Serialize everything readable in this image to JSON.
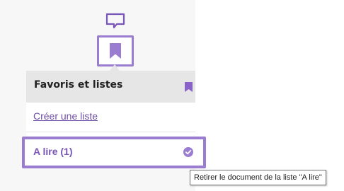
{
  "toolbar": {
    "comment_icon": "speech-bubble-icon",
    "bookmark_icon": "bookmark-icon"
  },
  "favorites_panel": {
    "title": "Favoris et listes",
    "header_icon": "bookmark-icon",
    "create_list_label": "Créer une liste",
    "lists": [
      {
        "label": "A lire (1)",
        "selected": true,
        "icon": "check-circle-icon"
      }
    ]
  },
  "tooltip": {
    "text": "Retirer le document de la liste \"A lire\""
  },
  "colors": {
    "accent": "#9a7dd0",
    "link": "#6e4fa5",
    "header_bg": "#e6e6e6"
  }
}
